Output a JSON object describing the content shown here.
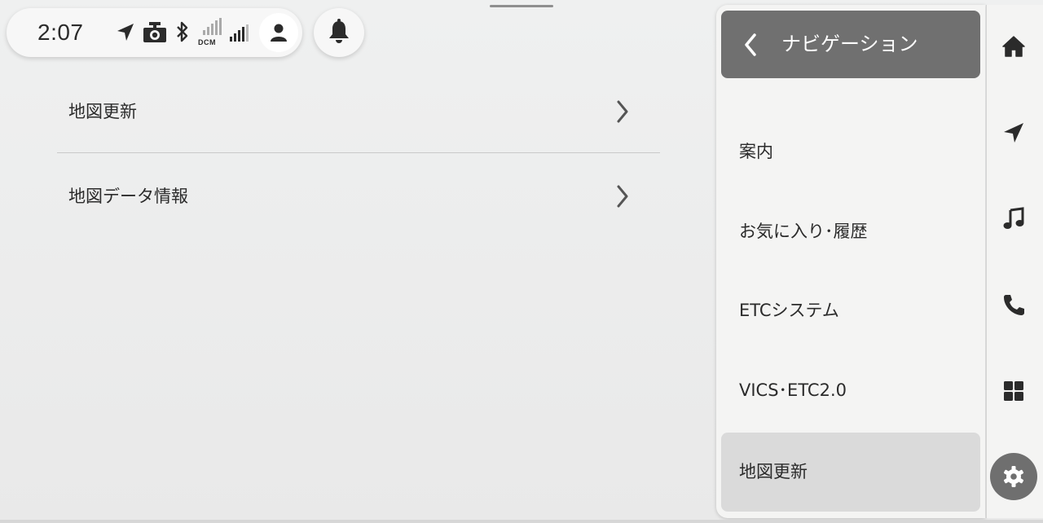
{
  "status_bar": {
    "time": "2:07",
    "icons": [
      "navigation-arrow-icon",
      "dashcam-icon",
      "bluetooth-icon",
      "dcm-signal-icon",
      "cell-signal-icon",
      "user-icon"
    ],
    "dcm_label": "DCM",
    "notification_icon": "bell-icon"
  },
  "main": {
    "items": [
      {
        "label": "地図更新"
      },
      {
        "label": "地図データ情報"
      }
    ]
  },
  "nav_panel": {
    "title": "ナビゲーション",
    "back_icon": "chevron-left-icon",
    "items": [
      {
        "label": "案内",
        "selected": false
      },
      {
        "label": "お気に入り･履歴",
        "selected": false
      },
      {
        "label": "ETCシステム",
        "selected": false
      },
      {
        "label": "VICS･ETC2.0",
        "selected": false
      },
      {
        "label": "地図更新",
        "selected": true
      }
    ]
  },
  "rail": {
    "icons": [
      "home-icon",
      "navigation-icon",
      "music-icon",
      "phone-icon",
      "apps-icon",
      "settings-icon"
    ],
    "active": "settings-icon"
  },
  "colors": {
    "background": "#ececec",
    "panel_header": "#707070",
    "selected_item": "#dadada",
    "text": "#2b2b2b"
  }
}
